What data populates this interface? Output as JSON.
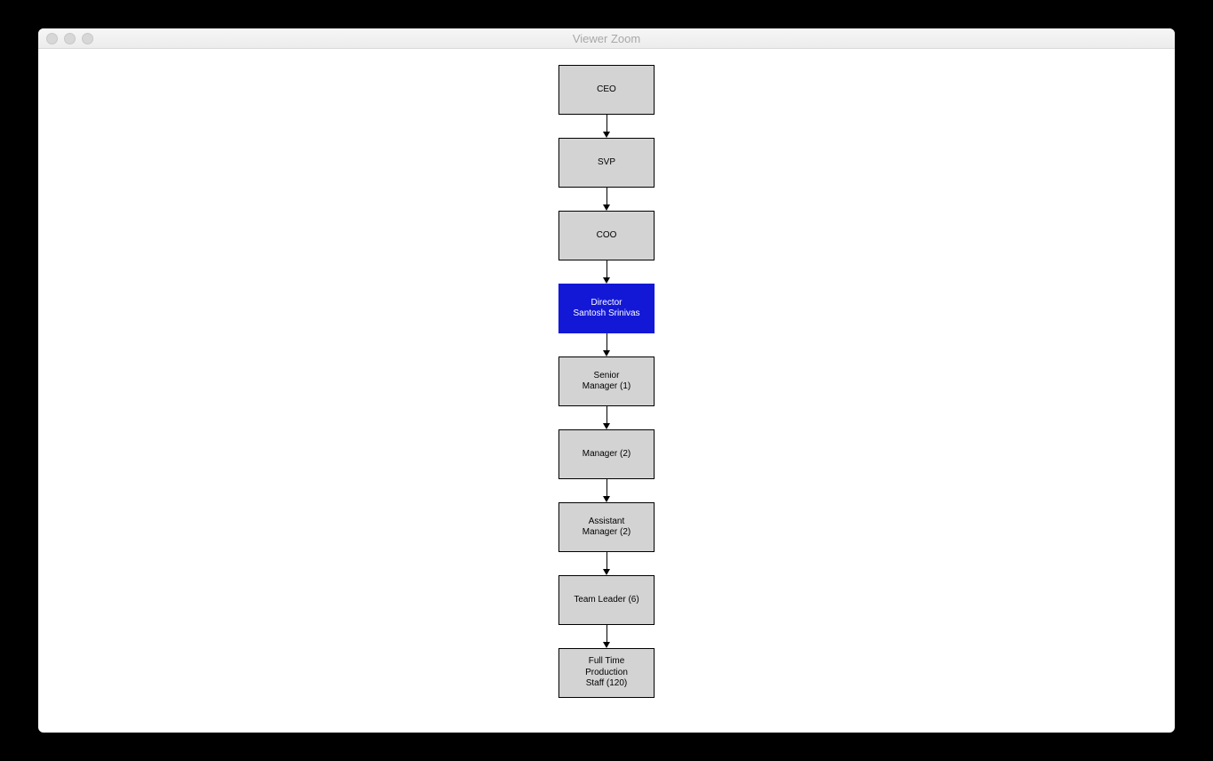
{
  "window": {
    "title": "Viewer Zoom"
  },
  "diagram": {
    "nodes": [
      {
        "label": "CEO",
        "highlight": false
      },
      {
        "label": "SVP",
        "highlight": false
      },
      {
        "label": "COO",
        "highlight": false
      },
      {
        "label": "Director\nSantosh Srinivas",
        "highlight": true
      },
      {
        "label": "Senior\nManager (1)",
        "highlight": false
      },
      {
        "label": "Manager (2)",
        "highlight": false
      },
      {
        "label": "Assistant\nManager (2)",
        "highlight": false
      },
      {
        "label": "Team Leader (6)",
        "highlight": false
      },
      {
        "label": "Full Time\nProduction\nStaff (120)",
        "highlight": false
      }
    ]
  }
}
